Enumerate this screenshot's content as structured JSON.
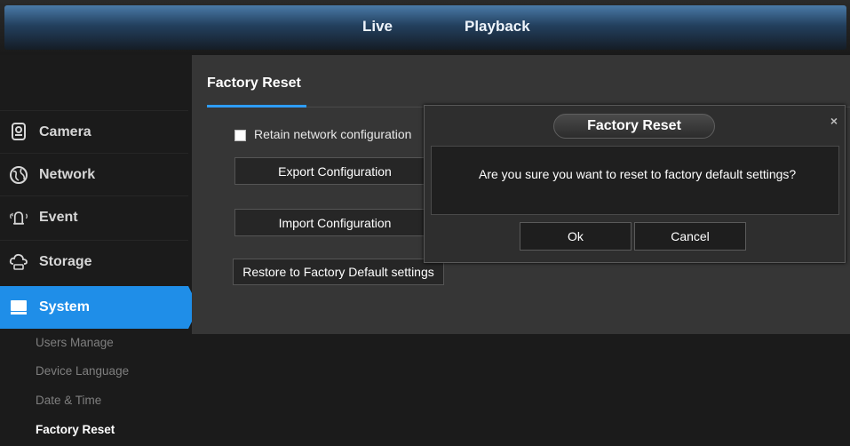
{
  "top_nav": {
    "tabs": [
      {
        "label": "Live"
      },
      {
        "label": "Playback"
      }
    ]
  },
  "sidebar": {
    "items": [
      {
        "label": "Camera",
        "icon": "camera-icon"
      },
      {
        "label": "Network",
        "icon": "network-globe-icon"
      },
      {
        "label": "Event",
        "icon": "event-alarm-icon"
      },
      {
        "label": "Storage",
        "icon": "storage-cloud-icon"
      },
      {
        "label": "System",
        "icon": "monitor-icon",
        "active": true
      }
    ],
    "sub_items": [
      {
        "label": "Users Manage"
      },
      {
        "label": "Device Language"
      },
      {
        "label": "Date & Time"
      },
      {
        "label": "Factory Reset",
        "current": true
      }
    ]
  },
  "content": {
    "title": "Factory Reset",
    "retain_network_label": "Retain network configuration",
    "export_button": "Export Configuration",
    "import_button": "Import Configuration",
    "restore_button": "Restore to Factory Default settings"
  },
  "dialog": {
    "title": "Factory Reset",
    "close_glyph": "×",
    "message": "Are you sure you want to reset to factory default settings?",
    "ok_label": "Ok",
    "cancel_label": "Cancel"
  },
  "colors": {
    "accent": "#1f8ee8",
    "panel": "#363636",
    "background": "#1b1b1b"
  }
}
